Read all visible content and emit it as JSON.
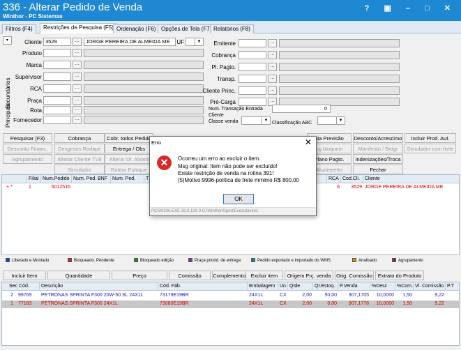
{
  "window": {
    "title": "336 - Alterar Pedido de Venda",
    "subtitle": "Winthor - PC Sistemas",
    "controls": "? ▣ – □ ✕"
  },
  "tabs": [
    "Filtros (F4)",
    "Restrições de Pesquisa (F5)",
    "Ordenação (F6)",
    "Opções de Tela (F7)",
    "Relatórios (F8)"
  ],
  "side_labels": {
    "principais": "Principais",
    "secundarios": "Secundários"
  },
  "filters": {
    "cliente_label": "Cliente",
    "cliente_code": "3529",
    "cliente_name": "JORGE PEREIRA DE ALMEIDA ME",
    "uf_label": "UF",
    "produto_label": "Produto",
    "marca_label": "Marca",
    "supervisor_label": "Supervisor",
    "rca_label": "RCA",
    "praca_label": "Praça",
    "rota_label": "Rota",
    "fornecedor_label": "Fornecedor",
    "emitente_label": "Emitente",
    "cobranca_label": "Cobrança",
    "plpagto_label": "Pl. Pagto.",
    "transp_label": "Transp.",
    "clienteprinc_label": "Cliente Princ.",
    "precarga_label": "Pré-Carga",
    "numtrans_label": "Num. Transação Entrada",
    "numtrans_value": "0",
    "classevenda_label": "Cliente\nClasse venda",
    "classabc_label": "Classificação ABC"
  },
  "buttons_row1": [
    "Pesquisar (F3)",
    "Cobrança",
    "Cobr. todos Pedido",
    "",
    "",
    "",
    "ata Previsão",
    "Desconto/Acrescimo",
    "Incluir Prod. Aut."
  ],
  "buttons_row2": [
    "Desconto Financ.",
    "Desgeses Rodapé",
    "Entrega / Obs",
    "",
    "",
    "",
    "og bloqueio",
    "Manifesto / Brdgr",
    "Simulador com frete"
  ],
  "buttons_row3": [
    "Agrupamento",
    "Alterar Cliente TV8",
    "Alterar Dt. Alvará",
    "",
    "",
    "",
    "Plano Pagto.",
    "Indenizações/Troca"
  ],
  "buttons_row4": [
    "Simulador",
    "Ratear Estoque",
    "",
    "",
    "",
    "",
    "Abatimento",
    "Fechar"
  ],
  "grid1": {
    "headers": [
      "",
      "Filial",
      "Num.Pedido",
      "Num. Ped. BNF",
      "Num. Ped.",
      "T",
      "RCA",
      "Cod.Cli.",
      "Cliente"
    ],
    "row": {
      "marker": "+ *",
      "filial": "1",
      "num_pedido": "6012516",
      "rca": "6",
      "cod_cli": "3529",
      "cliente": "JORGE PEREIRA DE ALMEIDA ME"
    }
  },
  "legend": [
    {
      "label": "Liberado e Montado",
      "color": "#1f3fbf"
    },
    {
      "label": "Bloqueado. Pendente",
      "color": "#e02020"
    },
    {
      "label": "Bloqueado edição",
      "color": "#1c8c2a"
    },
    {
      "label": "Praça priorid. de entrega",
      "color": "#7a3a9a"
    },
    {
      "label": "Pedido exportado e importado do WMS",
      "color": "#1a8a8a"
    },
    {
      "label": "Analisado",
      "color": "#e08a00"
    },
    {
      "label": "Agrupamento",
      "color": "#8a2a2a"
    }
  ],
  "toolbar2": [
    "Incluir Item",
    "Quantidade",
    "Preço",
    "Comissão",
    "Complemento Item",
    "Excluir item",
    "Origem Prç. venda",
    "Orig. Comissão",
    "Extrato do Produto"
  ],
  "grid2": {
    "headers": [
      "Sec",
      "Cód.",
      "Descrição",
      "Cód. Fáb.",
      "Embalagem",
      "Un",
      "Qtde",
      "Qt.Estoq.",
      "P.Venda",
      "%Desc",
      "%Com.",
      "Vl. Comissão",
      "P.T"
    ],
    "rows": [
      {
        "sec": "2",
        "cod": "99769",
        "desc": "PETRONAS SPRINTA F300 20W-50 SL 24X1L",
        "fab": "73179E19BR",
        "emb": "24X1L",
        "un": "CX",
        "qtde": "2,00",
        "estoq": "50,00",
        "pvenda": "307,1705",
        "desc_pct": "10,0000",
        "com": "1,50",
        "vlcom": "9,22"
      },
      {
        "sec": "1",
        "cod": "77183",
        "desc": "PETRONAS SPRINTA F300 24X1L",
        "fab": "73080E19BR",
        "emb": "24X1L",
        "un": "CX",
        "qtde": "2,00",
        "estoq": "0,00",
        "pvenda": "307,1778",
        "desc_pct": "10,0000",
        "com": "1,50",
        "vlcom": "9,22"
      }
    ]
  },
  "dialog": {
    "title": "Erro",
    "close": "✕",
    "lines": [
      "Ocorreu um erro ao excluir o item.",
      "Msg original: Item não pode ser excluído!",
      "Existe restrição de venda na rotina 391!",
      "(5)Motivo:9996-política de frete mínimo R$ 800,00"
    ],
    "ok": "OK",
    "footer": "PCSI0336.EXE 29.0.120.0 C:\\Winthor\\Sport\\Executaveis\\"
  }
}
